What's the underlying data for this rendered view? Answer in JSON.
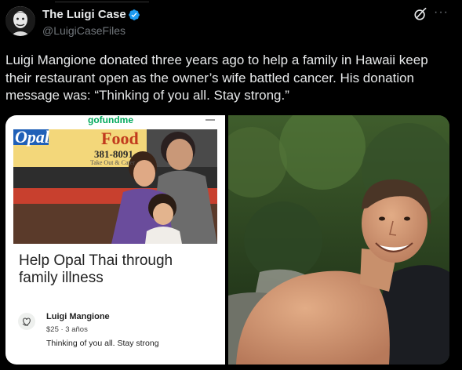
{
  "author": {
    "name": "The Luigi Case",
    "handle": "@LuigiCaseFiles"
  },
  "icons": {
    "verified": "verified-badge-icon",
    "grok": "grok-icon",
    "more": "more-icon"
  },
  "tweet": {
    "text": "Luigi Mangione donated three years ago to help a family in Hawaii keep their restaurant open as the owner’s wife battled cancer. His donation message was: “Thinking of you all. Stay strong.”"
  },
  "gofundme": {
    "logo": "gofundme",
    "sign_text": "Opal",
    "sign_food": "Food",
    "sign_phone": "381-8091",
    "sign_sub": "Take Out & Cater",
    "title": "Help Opal Thai through family illness",
    "donor_name": "Luigi Mangione",
    "donor_amount": "$25 · 3 años",
    "donor_message": "Thinking of you all. Stay strong"
  },
  "colors": {
    "accent_blue": "#1d9bf0",
    "gofundme_green": "#02a95c",
    "text_primary": "#e7e9ea",
    "text_secondary": "#71767b"
  }
}
